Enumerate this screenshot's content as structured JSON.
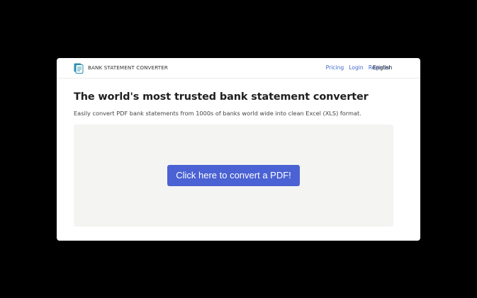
{
  "header": {
    "logo_icon": "document-stack-icon",
    "brand": "BANK STATEMENT CONVERTER",
    "nav": [
      {
        "label": "Pricing"
      },
      {
        "label": "Login"
      },
      {
        "label": "Register"
      }
    ],
    "language": "English"
  },
  "main": {
    "headline": "The world's most trusted bank statement converter",
    "subheadline": "Easily convert PDF bank statements from 1000s of banks world wide into clean Excel (XLS) format.",
    "cta_label": "Click here to convert a PDF!"
  },
  "colors": {
    "accent": "#4a62d3",
    "link": "#3f68c9",
    "logo": "#2b8fb0",
    "dropzone_bg": "#f4f4f2",
    "backdrop": "#000000"
  }
}
